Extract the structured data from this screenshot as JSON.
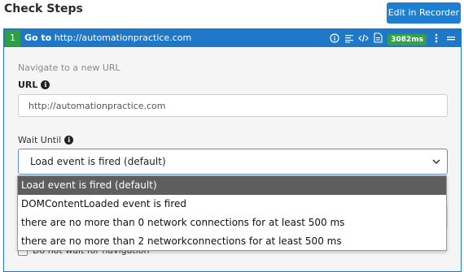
{
  "header": {
    "title": "Check Steps",
    "edit_button": "Edit in Recorder"
  },
  "step": {
    "number": "1",
    "verb": "Go to",
    "target": "http://automationpractice.com",
    "duration_badge": "3082ms",
    "icons": [
      "info-icon",
      "list-icon",
      "code-icon",
      "file-icon",
      "more-vertical-icon",
      "drag-handle-icon"
    ]
  },
  "form": {
    "hint": "Navigate to a new URL",
    "url_label": "URL",
    "url_value": "http://automationpractice.com",
    "wait_label": "Wait Until",
    "wait_selected": "Load event is fired (default)",
    "checkbox_label": "Do not wait for navigation"
  },
  "dropdown": {
    "options": [
      "Load event is fired (default)",
      "DOMContentLoaded event is fired",
      "there are no more than 0 network connections for at least 500 ms",
      "there are no more than 2 networkconnections for at least 500 ms"
    ],
    "selected_index": 0
  },
  "colors": {
    "accent": "#1f78c7",
    "step_number_bg": "#2f9e47",
    "badge_bg": "#33a04a",
    "selected_option_bg": "#5e5e5e"
  }
}
